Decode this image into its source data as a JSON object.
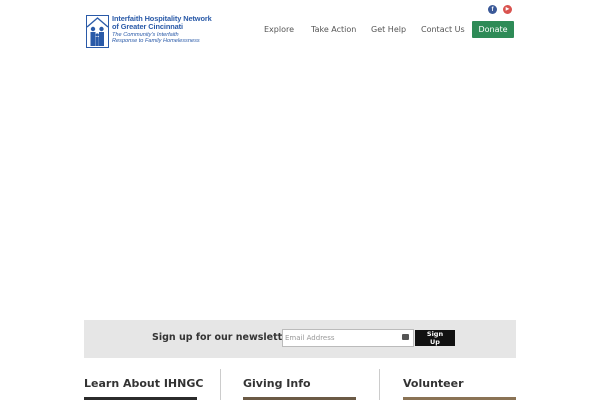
{
  "brand": {
    "line1": "Interfaith Hospitality Network",
    "line2": "of Greater Cincinnati",
    "line3": "The Community's Interfaith",
    "line4": "Response to Family Homelessness",
    "color": "#2a5aa8"
  },
  "social": {
    "facebook_glyph": "f",
    "youtube_glyph": "▶"
  },
  "nav": {
    "items": [
      "Explore",
      "Take Action",
      "Get Help",
      "Contact Us"
    ],
    "donate_label": "Donate",
    "donate_color": "#2e8b57"
  },
  "newsletter": {
    "label": "Sign up for our newsletter!",
    "placeholder": "Email Address",
    "button_label": "Sign Up"
  },
  "columns": [
    {
      "title": "Learn About IHNGC"
    },
    {
      "title": "Giving Info"
    },
    {
      "title": "Volunteer"
    }
  ]
}
